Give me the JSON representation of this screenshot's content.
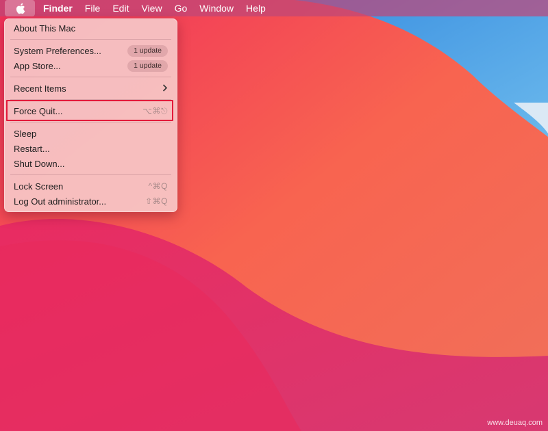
{
  "menubar": {
    "app_name": "Finder",
    "items": [
      "File",
      "Edit",
      "View",
      "Go",
      "Window",
      "Help"
    ]
  },
  "apple_menu": {
    "about": "About This Mac",
    "system_prefs": "System Preferences...",
    "system_prefs_badge": "1 update",
    "app_store": "App Store...",
    "app_store_badge": "1 update",
    "recent_items": "Recent Items",
    "force_quit": "Force Quit...",
    "force_quit_shortcut": "⌥⌘⎋",
    "sleep": "Sleep",
    "restart": "Restart...",
    "shut_down": "Shut Down...",
    "lock_screen": "Lock Screen",
    "lock_screen_shortcut": "^⌘Q",
    "log_out": "Log Out administrator...",
    "log_out_shortcut": "⇧⌘Q"
  },
  "watermark": "www.deuaq.com",
  "colors": {
    "highlight": "#e31a3a",
    "menubar": "#be4678"
  }
}
